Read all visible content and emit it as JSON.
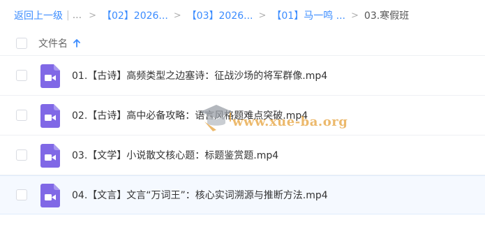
{
  "breadcrumb": {
    "back_label": "返回上一级",
    "ellipsis": "...",
    "crumbs": [
      "【02】2026...",
      "【03】2026...",
      "【01】马一鸣 ..."
    ],
    "current": "03.寒假班"
  },
  "list_header": {
    "column_label": "文件名",
    "sort_direction": "ascending"
  },
  "files": [
    {
      "name": "01.【古诗】高频类型之边塞诗：征战沙场的将军群像.mp4",
      "type": "video"
    },
    {
      "name": "02.【古诗】高中必备攻略：语言风格题难点突破.mp4",
      "type": "video"
    },
    {
      "name": "03.【文学】小说散文核心题：标题鉴赏题.mp4",
      "type": "video"
    },
    {
      "name": "04.【文言】文言“万词王”：核心实词溯源与推断方法.mp4",
      "type": "video"
    }
  ],
  "watermark": {
    "text": "www.xue-ba.org"
  },
  "colors": {
    "link": "#3b8cff",
    "video_icon": "#8068e6",
    "watermark": "#e6a23c"
  }
}
